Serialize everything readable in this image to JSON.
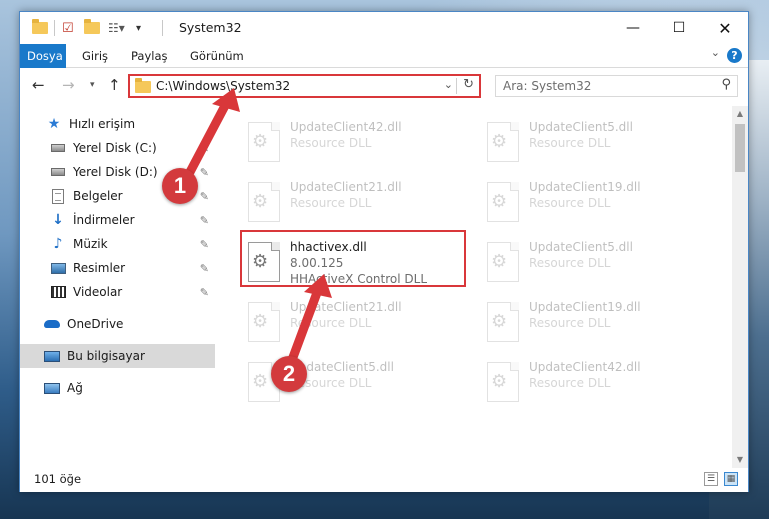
{
  "window": {
    "title": "System32"
  },
  "tabs": [
    {
      "label": "Dosya",
      "active": true
    },
    {
      "label": "Giriş",
      "active": false
    },
    {
      "label": "Paylaş",
      "active": false
    },
    {
      "label": "Görünüm",
      "active": false
    }
  ],
  "address": {
    "path": "C:\\Windows\\System32"
  },
  "search": {
    "placeholder": "Ara: System32"
  },
  "sidebar": {
    "items": [
      {
        "label": "Hızlı erişim",
        "icon": "star-icon",
        "pinned": false
      },
      {
        "label": "Yerel Disk (C:)",
        "icon": "drive-icon",
        "pinned": true
      },
      {
        "label": "Yerel Disk (D:)",
        "icon": "drive-icon",
        "pinned": true
      },
      {
        "label": "Belgeler",
        "icon": "documents-icon",
        "pinned": true
      },
      {
        "label": "İndirmeler",
        "icon": "download-icon",
        "pinned": true
      },
      {
        "label": "Müzik",
        "icon": "music-icon",
        "pinned": true
      },
      {
        "label": "Resimler",
        "icon": "pictures-icon",
        "pinned": true
      },
      {
        "label": "Videolar",
        "icon": "videos-icon",
        "pinned": true
      },
      {
        "label": "OneDrive",
        "icon": "cloud-icon",
        "pinned": false
      },
      {
        "label": "Bu bilgisayar",
        "icon": "computer-icon",
        "pinned": false,
        "selected": true
      },
      {
        "label": "Ağ",
        "icon": "network-icon",
        "pinned": false
      }
    ]
  },
  "files": [
    {
      "name": "UpdateClient42.dll",
      "type": "Resource DLL",
      "faded": true
    },
    {
      "name": "UpdateClient5.dll",
      "type": "Resource DLL",
      "faded": true
    },
    {
      "name": "UpdateClient21.dll",
      "type": "Resource DLL",
      "faded": true
    },
    {
      "name": "UpdateClient19.dll",
      "type": "Resource DLL",
      "faded": true
    },
    {
      "name": "hhactivex.dll",
      "version": "8.00.125",
      "type": "HHActiveX Control DLL",
      "faded": false
    },
    {
      "name": "UpdateClient5.dll",
      "type": "Resource DLL",
      "faded": true
    },
    {
      "name": "UpdateClient21.dll",
      "type": "Resource DLL",
      "faded": true
    },
    {
      "name": "UpdateClient19.dll",
      "type": "Resource DLL",
      "faded": true
    },
    {
      "name": "UpdateClient5.dll",
      "type": "Resource DLL",
      "faded": true
    },
    {
      "name": "UpdateClient42.dll",
      "type": "Resource DLL",
      "faded": true
    }
  ],
  "status": {
    "count": "101 öğe"
  },
  "annotations": {
    "step1": "1",
    "step2": "2",
    "color": "#d9373a"
  }
}
